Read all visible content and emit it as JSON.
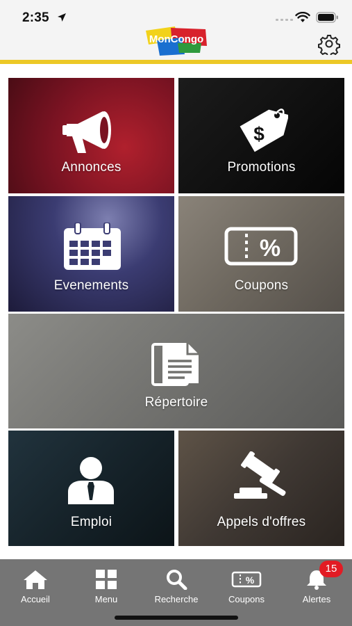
{
  "status_bar": {
    "time": "2:35"
  },
  "header": {
    "logo_text": "MonCongo"
  },
  "tiles": [
    {
      "label": "Annonces"
    },
    {
      "label": "Promotions"
    },
    {
      "label": "Evenements"
    },
    {
      "label": "Coupons"
    },
    {
      "label": "Répertoire"
    },
    {
      "label": "Emploi"
    },
    {
      "label": "Appels d'offres"
    }
  ],
  "tabbar": {
    "items": [
      {
        "label": "Accueil",
        "icon": "home-icon"
      },
      {
        "label": "Menu",
        "icon": "grid-icon"
      },
      {
        "label": "Recherche",
        "icon": "search-icon"
      },
      {
        "label": "Coupons",
        "icon": "coupon-icon"
      },
      {
        "label": "Alertes",
        "icon": "bell-icon"
      }
    ],
    "alert_badge": "15"
  },
  "colors": {
    "accent_yellow": "#ecc826",
    "tabbar_bg": "#757575",
    "badge_red": "#e21b24"
  }
}
